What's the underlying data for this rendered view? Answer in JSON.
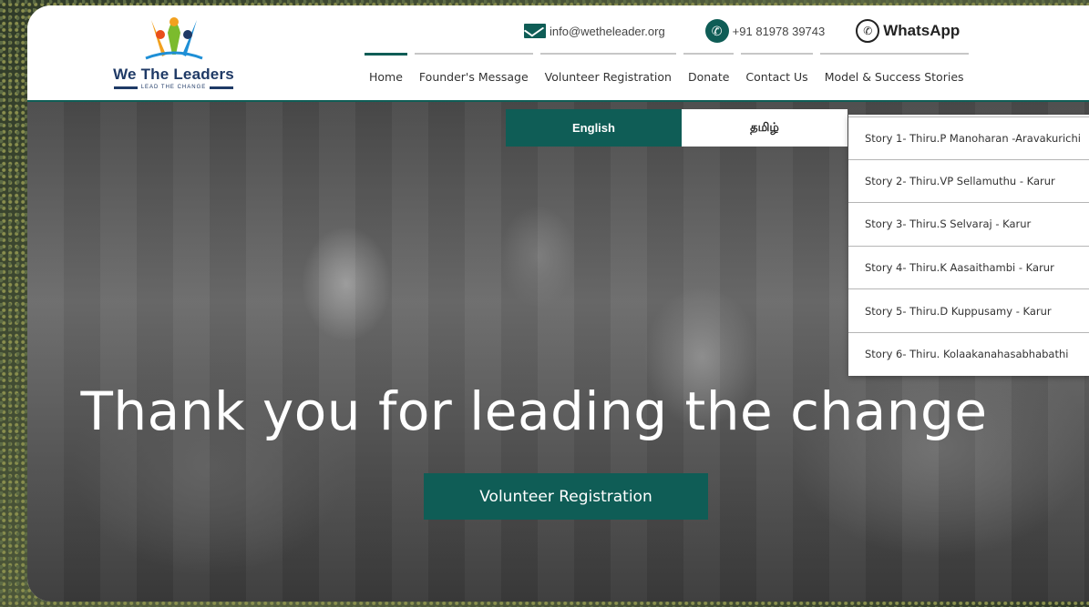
{
  "brand": {
    "name": "We The Leaders",
    "tagline": "LEAD THE CHANGE",
    "accent": "#0f5d56"
  },
  "contact": {
    "email": "info@wetheleader.org",
    "phone": "+91 81978 39743",
    "whatsapp": "WhatsApp"
  },
  "nav": {
    "items": [
      {
        "label": "Home",
        "active": true
      },
      {
        "label": "Founder's Message"
      },
      {
        "label": "Volunteer Registration"
      },
      {
        "label": "Donate"
      },
      {
        "label": "Contact Us"
      },
      {
        "label": "Model & Success Stories"
      }
    ]
  },
  "language": {
    "english": "English",
    "tamil": "தமிழ்"
  },
  "stories": {
    "items": [
      {
        "label": "Story 1- Thiru.P Manoharan -Aravakurichi"
      },
      {
        "label": "Story 2- Thiru.VP Sellamuthu - Karur"
      },
      {
        "label": "Story 3- Thiru.S Selvaraj - Karur"
      },
      {
        "label": "Story 4- Thiru.K Aasaithambi - Karur"
      },
      {
        "label": "Story 5- Thiru.D Kuppusamy - Karur"
      },
      {
        "label": "Story 6- Thiru. Kolaakanahasabhabathi"
      }
    ]
  },
  "hero": {
    "title": "Thank you for leading the change",
    "cta": "Volunteer Registration"
  }
}
